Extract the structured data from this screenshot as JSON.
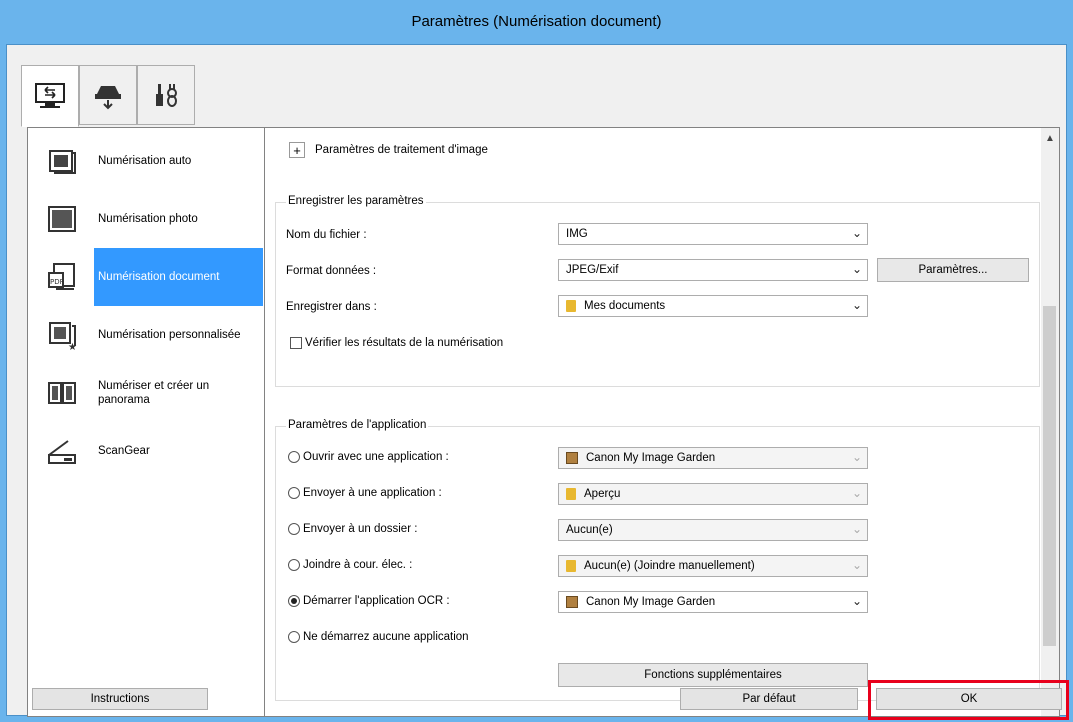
{
  "window": {
    "title": "Paramètres (Numérisation document)"
  },
  "tabs": [
    {
      "icon": "scan-from-computer-icon"
    },
    {
      "icon": "scan-from-operation-panel-icon"
    },
    {
      "icon": "general-settings-icon"
    }
  ],
  "sidebar": {
    "items": [
      {
        "label": "Numérisation auto",
        "icon": "auto-scan-icon"
      },
      {
        "label": "Numérisation photo",
        "icon": "photo-scan-icon"
      },
      {
        "label": "Numérisation document",
        "icon": "document-scan-icon",
        "selected": true
      },
      {
        "label": "Numérisation personnalisée",
        "icon": "custom-scan-icon"
      },
      {
        "label": "Numériser et créer un panorama",
        "icon": "panorama-scan-icon"
      },
      {
        "label": "ScanGear",
        "icon": "scangear-icon"
      }
    ]
  },
  "image_processing": {
    "label": "Paramètres de traitement d'image",
    "expand": "+"
  },
  "save_settings": {
    "title": "Enregistrer les paramètres",
    "filename_label": "Nom du fichier :",
    "filename_value": "IMG",
    "format_label": "Format données :",
    "format_value": "JPEG/Exif",
    "format_settings_button": "Paramètres...",
    "save_in_label": "Enregistrer dans :",
    "save_in_value": "Mes documents",
    "check_results_label": "Vérifier les résultats de la numérisation"
  },
  "app_settings": {
    "title": "Paramètres de l'application",
    "options": [
      {
        "label": "Ouvrir avec une application :",
        "value": "Canon My Image Garden",
        "icon": "app",
        "selected": false,
        "enabled": false
      },
      {
        "label": "Envoyer à une application :",
        "value": "Aperçu",
        "icon": "folder",
        "selected": false,
        "enabled": false
      },
      {
        "label": "Envoyer à un dossier :",
        "value": "Aucun(e)",
        "icon": "",
        "selected": false,
        "enabled": false
      },
      {
        "label": "Joindre à cour. élec. :",
        "value": "Aucun(e) (Joindre manuellement)",
        "icon": "folder",
        "selected": false,
        "enabled": false
      },
      {
        "label": "Démarrer l'application OCR :",
        "value": "Canon My Image Garden",
        "icon": "app",
        "selected": true,
        "enabled": true
      },
      {
        "label": "Ne démarrez aucune application",
        "selected": false
      }
    ],
    "more_functions_button": "Fonctions supplémentaires"
  },
  "footer": {
    "instructions_button": "Instructions",
    "defaults_button": "Par défaut",
    "ok_button": "OK"
  },
  "colors": {
    "accent": "#3399ff",
    "title_bar": "#6ab4ec",
    "highlight": "#e8001c"
  }
}
